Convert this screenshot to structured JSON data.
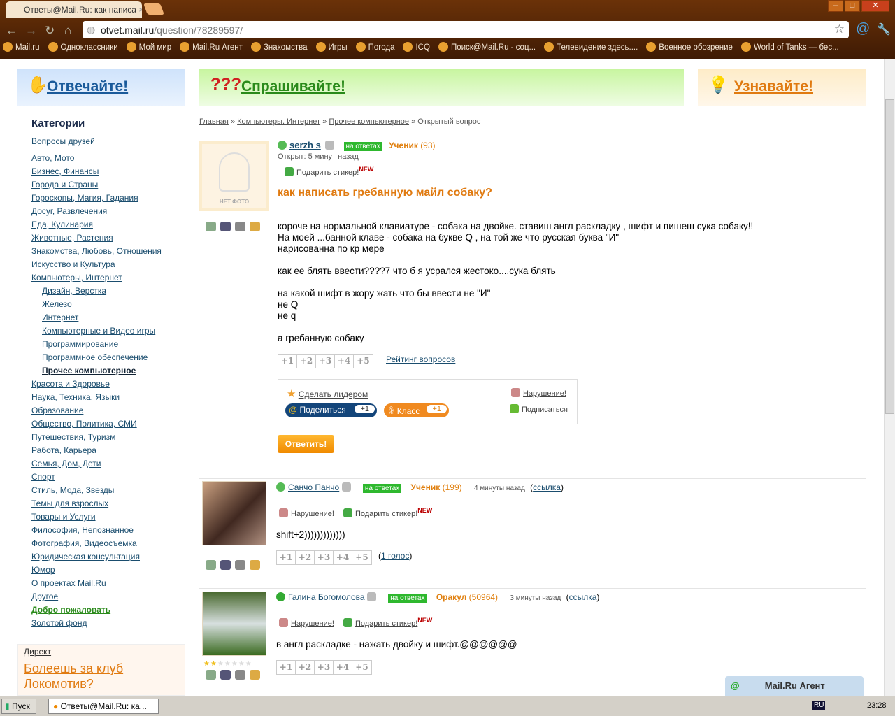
{
  "browser": {
    "tab_title": "Ответы@Mail.Ru: как написа",
    "url_host": "otvet.mail.ru",
    "url_path": "/question/78289597/",
    "bookmarks": [
      "Mail.ru",
      "Одноклассники",
      "Мой мир",
      "Mail.Ru Агент",
      "Знакомства",
      "Игры",
      "Погода",
      "ICQ",
      "Поиск@Mail.Ru - соц...",
      "Телевидение здесь....",
      "Военное обозрение",
      "World of Tanks — бес..."
    ]
  },
  "header": {
    "answer": "Отвечайте!",
    "ask": "Спрашивайте!",
    "learn": "Узнавайте!"
  },
  "sidebar": {
    "title": "Категории",
    "friends": "Вопросы друзей",
    "categories": [
      "Авто, Мото",
      "Бизнес, Финансы",
      "Города и Страны",
      "Гороскопы, Магия, Гадания",
      "Досуг, Развлечения",
      "Еда, Кулинария",
      "Животные, Растения",
      "Знакомства, Любовь, Отношения",
      "Искусство и Культура",
      "Компьютеры, Интернет"
    ],
    "subcategories": [
      "Дизайн, Верстка",
      "Железо",
      "Интернет",
      "Компьютерные и Видео игры",
      "Программирование",
      "Программное обеспечение",
      "Прочее компьютерное"
    ],
    "categories2": [
      "Красота и Здоровье",
      "Наука, Техника, Языки",
      "Образование",
      "Общество, Политика, СМИ",
      "Путешествия, Туризм",
      "Работа, Карьера",
      "Семья, Дом, Дети",
      "Спорт",
      "Стиль, Мода, Звезды",
      "Темы для взрослых",
      "Товары и Услуги",
      "Философия, Непознанное",
      "Фотография, Видеосъемка",
      "Юридическая консультация",
      "Юмор",
      "О проектах Mail.Ru",
      "Другое"
    ],
    "welcome": "Добро пожаловать",
    "gold": "Золотой фонд",
    "direct": "Директ",
    "ad": "Болеешь за клуб Локомотив?"
  },
  "breadcrumb": {
    "home": "Главная",
    "cat": "Компьютеры, Интернет",
    "sub": "Прочее компьютерное",
    "current": "Открытый вопрос",
    "sep": "»"
  },
  "question": {
    "no_photo": "НЕТ ФОТО",
    "author": "serzh s",
    "badge": "на ответах",
    "rank": "Ученик",
    "points": "(93)",
    "opened": "Открыт: 5 минут назад",
    "sticker": "Подарить стикер!",
    "new": "NEW",
    "title": "как написать гребанную майл собаку?",
    "body": "короче на нормальной клавиатуре - собака на двойке. ставиш англ раскладку , шифт и пишеш сука собаку!!\nНа моей ...банной клаве - собака на букве Q , на той же что русская буква \"И\"\nнарисованна по кр мере\n\nкак ее блять ввести????7 что б я усрался жестоко....сука блять\n\nна какой шифт в жору жать что бы ввести не \"И\"\nне Q\nне q\n\nа гребанную собаку",
    "votes": [
      "+1",
      "+2",
      "+3",
      "+4",
      "+5"
    ],
    "rating_link": "Рейтинг вопросов",
    "make_leader": "Сделать лидером",
    "violation": "Нарушение!",
    "subscribe": "Подписаться",
    "share": "Поделиться",
    "share_count": "+1",
    "klass": "Класс",
    "klass_count": "+1",
    "reply": "Ответить!"
  },
  "answers": [
    {
      "author": "Санчо Панчо",
      "badge": "на ответах",
      "rank": "Ученик",
      "points": "(199)",
      "time": "4 минуты назад",
      "link": "ссылка",
      "violation": "Нарушение!",
      "sticker": "Подарить стикер!",
      "new": "NEW",
      "text": "shift+2)))))))))))))",
      "votes_link": "1 голос"
    },
    {
      "author": "Галина Богомолова",
      "badge": "на ответах",
      "rank": "Оракул",
      "points": "(50964)",
      "time": "3 минуты назад",
      "link": "ссылка",
      "violation": "Нарушение!",
      "sticker": "Подарить стикер!",
      "new": "NEW",
      "text": "в англ раскладке - нажать двойку и шифт.@@@@@@"
    }
  ],
  "agent": {
    "label": "Mail.Ru Агент"
  },
  "taskbar": {
    "start": "Пуск",
    "window": "Ответы@Mail.Ru: ка...",
    "lang": "RU",
    "clock": "23:28"
  }
}
